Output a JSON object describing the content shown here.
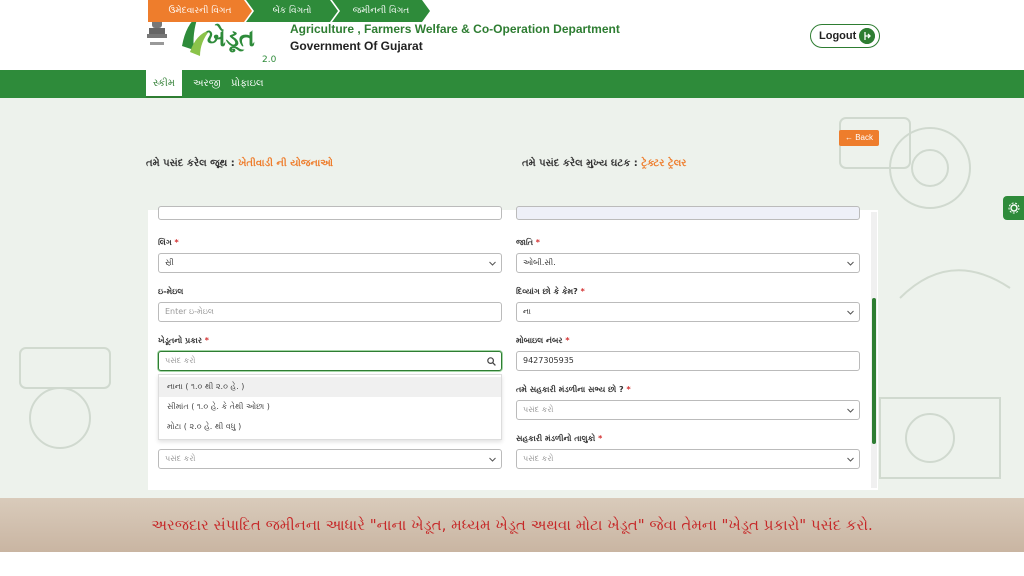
{
  "header": {
    "logo_text": "ખેડૂત",
    "logo_version": "2.0",
    "department": "Agriculture , Farmers Welfare & Co-Operation Department",
    "government": "Government Of Gujarat",
    "logout_label": "Logout"
  },
  "nav": {
    "items": [
      {
        "label": "સ્કીમ",
        "active": true
      },
      {
        "label": "અરજી",
        "active": false
      },
      {
        "label": "પ્રોફાઇલ",
        "active": false
      }
    ]
  },
  "back_label": "← Back",
  "selection": {
    "group_label": "તમે પસંદ કરેલ જૂથ :",
    "group_value": "ખેતીવાડી ની યોજનાઓ",
    "component_label": "તમે પસંદ કરેલ મુખ્ય ઘટક :",
    "component_value": "ટ્રેક્ટર ટ્રેલર"
  },
  "steps": [
    {
      "label": "ઉમેદવારની વિગત",
      "active": true
    },
    {
      "label": "બેંક વિગતો",
      "active": false
    },
    {
      "label": "જમીનની વિગત",
      "active": false
    }
  ],
  "form": {
    "gender_label": "લિંગ",
    "gender_value": "સ્રી",
    "caste_label": "જાતિ",
    "caste_value": "ઓબી.સી.",
    "email_label": "ઇ-મેઇલ",
    "email_placeholder": "Enter ઇ-મેઇલ",
    "disabled_label": "દિવ્યાંગ છો કે કેમ?",
    "disabled_value": "ના",
    "farmer_type_label": "ખેડૂતનો પ્રકાર",
    "farmer_type_placeholder": "પસંદ કરો",
    "mobile_label": "મોબાઇલ નંબર",
    "mobile_value": "9427305935",
    "coop_member_label": "તમે સહકારી મંડળીના સભ્ય છો ?",
    "coop_member_placeholder": "પસંદ કરો",
    "bottom_left_placeholder": "પસંદ કરો",
    "coop_taluka_label": "સહકારી મંડળીનો તાલુકો",
    "coop_taluka_placeholder": "પસંદ કરો",
    "required_mark": "*"
  },
  "farmer_type_options": [
    "નાના ( ૧.૦ થી ૨.૦ હે. )",
    "સીમાંત ( ૧.૦ હે. કે તેથી ઓછા )",
    "મોટા ( ૨.૦ હે. થી વધુ )"
  ],
  "caption": "અરજદાર સંપાદિત જમીનના આધારે \"નાના ખેડૂત, મધ્યમ ખેડૂત અથવા મોટા ખેડૂત\" જેવા તેમના \"ખેડૂત પ્રકારો\" પસંદ કરો.",
  "colors": {
    "brand_green": "#2e8b3a",
    "accent_orange": "#ee7d2c",
    "caption_red": "#c62828"
  }
}
